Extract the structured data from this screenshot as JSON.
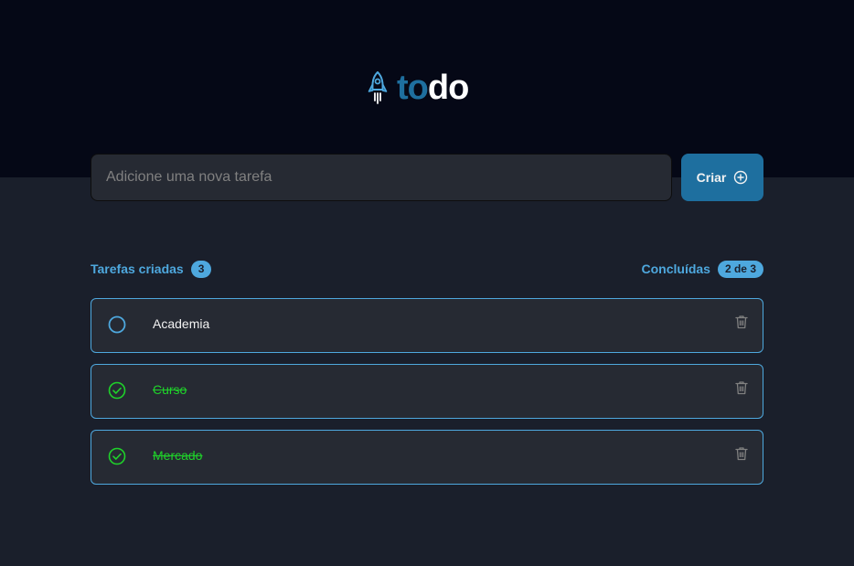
{
  "header": {
    "logo_part1": "to",
    "logo_part2": "do",
    "logo_icon": "rocket-icon"
  },
  "new_task": {
    "placeholder": "Adicione uma nova tarefa",
    "value": "",
    "create_label": "Criar",
    "create_icon": "plus-circle-icon"
  },
  "summary": {
    "created_label": "Tarefas criadas",
    "created_count": "3",
    "done_label": "Concluídas",
    "done_count": "2 de 3"
  },
  "tasks": [
    {
      "text": "Academia",
      "done": false
    },
    {
      "text": "Curso",
      "done": true
    },
    {
      "text": "Mercado",
      "done": true
    }
  ],
  "colors": {
    "header_bg": "#050816",
    "page_bg": "#1a1f2b",
    "accent_blue": "#1e6f9f",
    "light_blue": "#4ea8de",
    "done_green": "#1fd12a",
    "card_bg": "#262a33"
  }
}
